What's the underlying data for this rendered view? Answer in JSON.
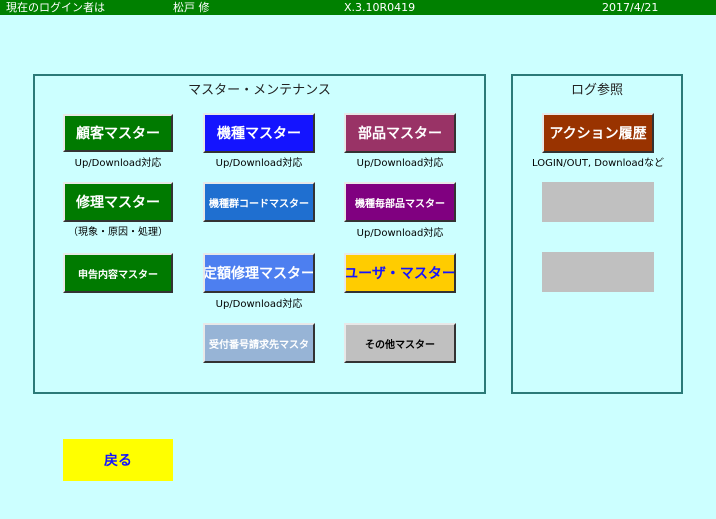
{
  "header": {
    "login_label": "現在のログイン者は",
    "user_name": "松戸 修",
    "version": "X.3.10R0419",
    "date": "2017/4/21"
  },
  "master_panel": {
    "title": "マスター・メンテナンス",
    "buttons": {
      "customer": "顧客マスター",
      "model": "機種マスター",
      "parts": "部品マスター",
      "repair": "修理マスター",
      "model_group_code": "機種群コードマスター",
      "model_parts": "機種毎部品マスター",
      "report": "申告内容マスター",
      "fixed_repair": "定額修理マスター",
      "user": "ユーザ・マスター",
      "billing": "受付番号請求先マスタ",
      "other": "その他マスター"
    },
    "notes": {
      "customer": "Up/Download対応",
      "model": "Up/Download対応",
      "parts": "Up/Download対応",
      "repair": "（現象・原因・処理）",
      "model_parts": "Up/Download対応",
      "fixed_repair": "Up/Download対応"
    }
  },
  "log_panel": {
    "title": "ログ参照",
    "action_history": "アクション履歴",
    "action_note": "LOGIN/OUT, Downloadなど"
  },
  "back_button": "戻る",
  "colors": {
    "background": "#ccffff",
    "header": "#008000",
    "green": "#007a00",
    "blue": "#1414ff",
    "maroon": "#993366",
    "royal": "#1f6fd0",
    "purple": "#800080",
    "cornflower": "#4d7ff0",
    "yellow": "#ffcc00",
    "steel": "#97b4d6",
    "grey": "#c0c0c0",
    "brown": "#993300",
    "back": "#ffff00"
  }
}
